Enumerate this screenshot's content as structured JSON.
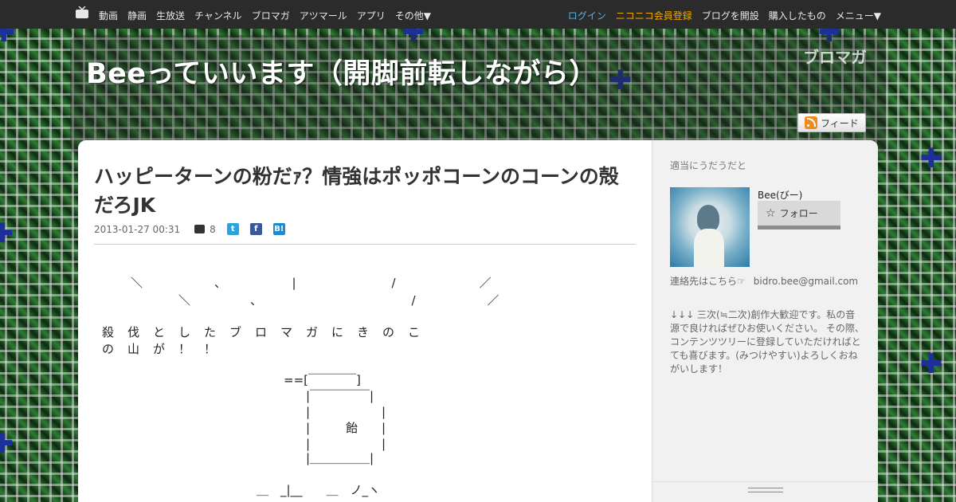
{
  "topbar": {
    "nav_left": [
      "動画",
      "静画",
      "生放送",
      "チャンネル",
      "ブロマガ",
      "アツマール",
      "アプリ",
      "その他▼"
    ],
    "nav_right": {
      "login": "ログイン",
      "register": "ニコニコ会員登録",
      "open_blog": "ブログを開設",
      "purchased": "購入したもの",
      "menu": "メニュー▼"
    }
  },
  "header": {
    "blog_title": "Beeっていいます（開脚前転しながら）",
    "brand_logo": "ブロマガ",
    "feed_label": "フィード"
  },
  "article": {
    "title": "ハッピーターンの粉だｧ？情強はポッポコーンのコーンの殻だろJK",
    "date": "2013-01-27 00:31",
    "comment_count": "8",
    "share": {
      "twitter": "t",
      "facebook": "f",
      "hatena": "B!"
    },
    "ascii_art": [
      "＼　　　　　　、　　　　　　|　　　　　　　　/　　　　　　　／",
      "＼　　　　　、　　　　　　　　　　　　　/　　　　　　／",
      "殺　伐　と　し　た　ブ　ロ　マ　ガ　に　き　の　こ",
      "の　山　が　！　！",
      "==[￣￣￣￣]",
      "|￣￣￣￣￣|",
      "|　　　　　　|",
      "|　　　飴　　|",
      "|　　　　　　|",
      "|＿＿＿＿＿|",
      "＿　_|__　　＿　ノ_ヽ"
    ]
  },
  "sidebar": {
    "caption": "適当にうだうだと",
    "author_name": "Bee(びー)",
    "follow_label": "フォロー",
    "contact_label": "連絡先はこちら☞",
    "contact_email": "bidro.bee@gmail.com",
    "profile_text": "↓↓↓ 三次(≒二次)創作大歓迎です。私の音源で良ければぜひお使いください。 その際、コンテンツツリーに登録していただければとても喜びます。(みつけやすい)よろしくおねがいします！"
  },
  "colors": {
    "topbar_bg": "#2b2b2b",
    "login": "#4db6e8",
    "register": "#f0a800",
    "background_pattern": "#1f4a24",
    "cross_ornament": "#1d2f9a"
  }
}
